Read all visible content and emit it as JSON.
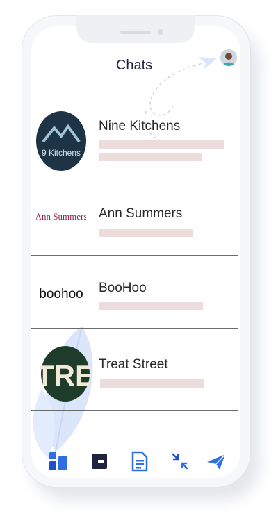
{
  "header": {
    "title": "Chats",
    "avatar_icon": "user-avatar"
  },
  "chats": [
    {
      "name": "Nine Kitchens",
      "logo_text": "9 Kitchens"
    },
    {
      "name": "Ann Summers",
      "logo_text": "Ann Summers"
    },
    {
      "name": "BooHoo",
      "logo_text": "boohoo"
    },
    {
      "name": "Treat Street",
      "logo_text": "TRE"
    }
  ],
  "nav": {
    "items": [
      "dashboard-icon",
      "window-icon",
      "document-icon",
      "compress-icon",
      "send-icon"
    ]
  },
  "colors": {
    "accent": "#2f6fe6",
    "dark": "#1f2340",
    "bar": "#ecdcdc",
    "divider": "#6a6a6a"
  }
}
